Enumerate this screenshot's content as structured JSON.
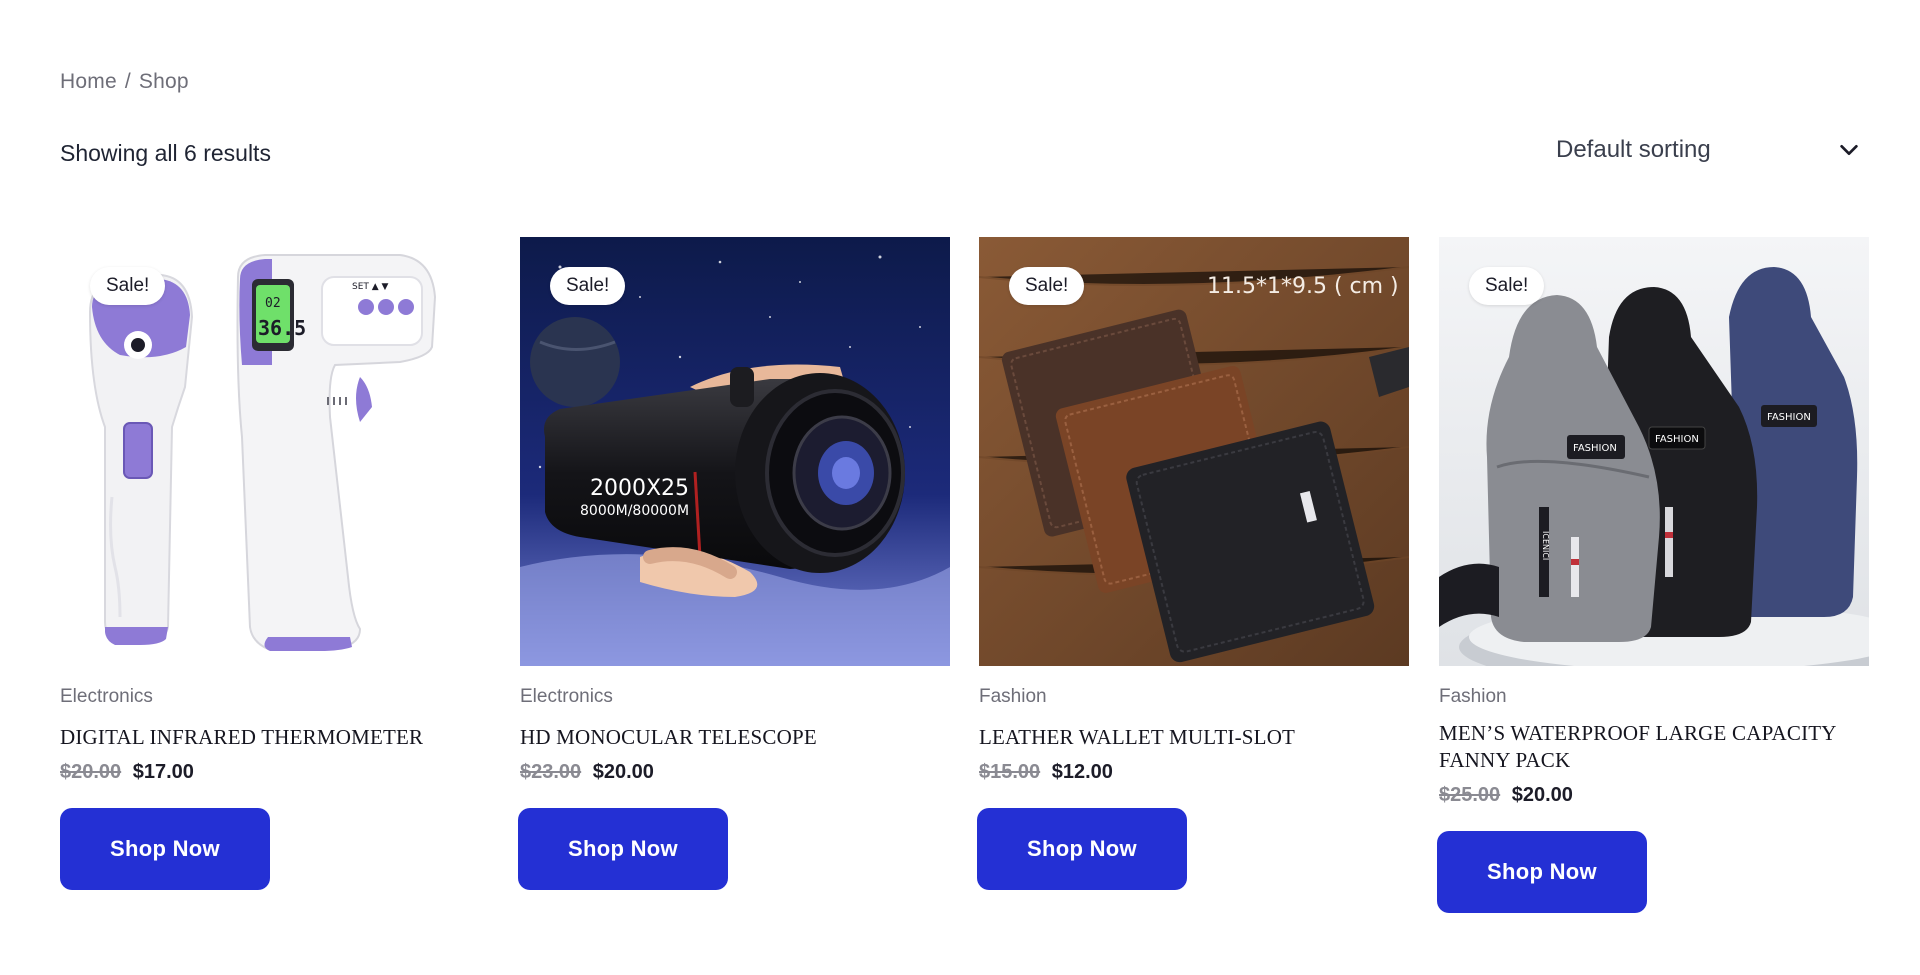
{
  "breadcrumb": {
    "home": "Home",
    "separator": "/",
    "current": "Shop"
  },
  "results": {
    "text": "Showing all 6 results"
  },
  "sorting": {
    "selected": "Default sorting",
    "icon": "chevron-down-icon"
  },
  "colors": {
    "button": "#2430d4",
    "price_old": "#8a8a92",
    "muted": "#6e6e78"
  },
  "products": [
    {
      "badge": "Sale!",
      "category": "Electronics",
      "title": "DIGITAL INFRARED THERMOMETER",
      "price_old": "$20.00",
      "price_new": "$17.00",
      "button": "Shop Now",
      "image_text": {
        "display_top": "02",
        "display_main": "36.5",
        "buttons": "SET ▲ ▼"
      }
    },
    {
      "badge": "Sale!",
      "category": "Electronics",
      "title": "HD MONOCULAR TELESCOPE",
      "price_old": "$23.00",
      "price_new": "$20.00",
      "button": "Shop Now",
      "image_text": {
        "line1": "2000X25",
        "line2": "8000M/80000M"
      }
    },
    {
      "badge": "Sale!",
      "category": "Fashion",
      "title": "LEATHER WALLET MULTI-SLOT",
      "price_old": "$15.00",
      "price_new": "$12.00",
      "button": "Shop Now",
      "image_text": {
        "dimensions": "11.5*1*9.5 ( cm )"
      }
    },
    {
      "badge": "Sale!",
      "category": "Fashion",
      "title": "MEN’S WATERPROOF LARGE CAPACITY FANNY PACK",
      "price_old": "$25.00",
      "price_new": "$20.00",
      "button": "Shop Now",
      "image_text": {
        "patch": "FASHION",
        "strap": "ICENICI"
      }
    }
  ]
}
